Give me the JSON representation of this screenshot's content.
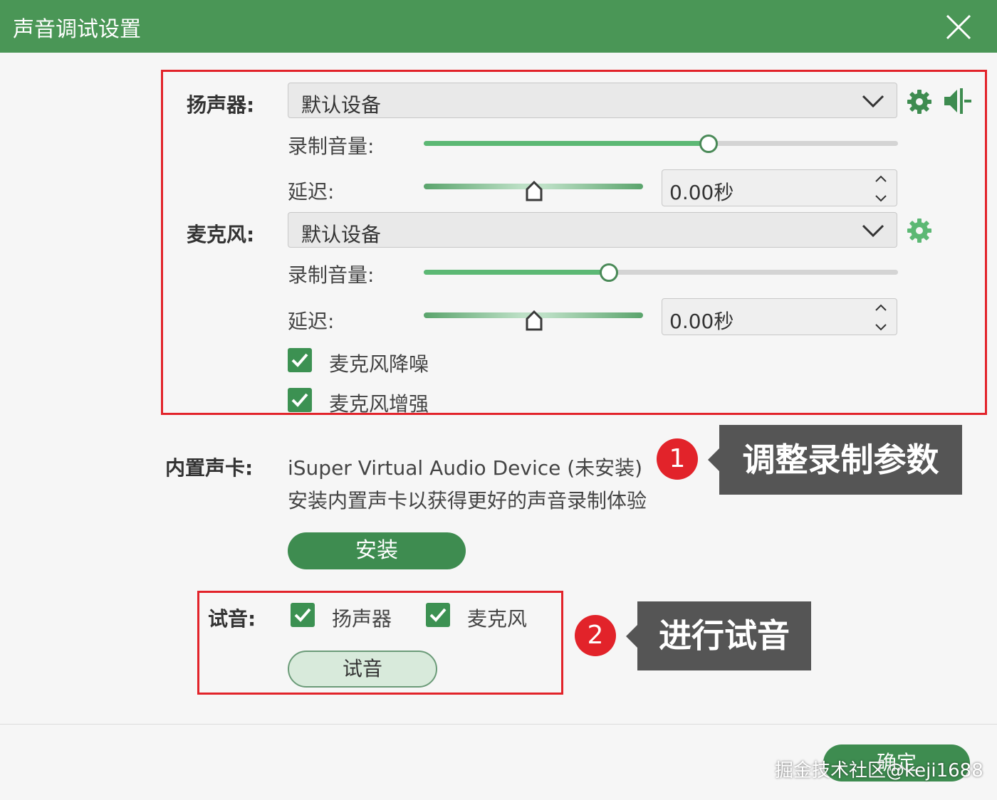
{
  "window": {
    "title": "声音调试设置"
  },
  "speaker": {
    "label": "扬声器:",
    "device": "默认设备",
    "volume_label": "录制音量:",
    "volume_level": 0.6,
    "delay_label": "延迟:",
    "delay_value": "0.00秒"
  },
  "microphone": {
    "label": "麦克风:",
    "device": "默认设备",
    "volume_label": "录制音量:",
    "volume_level": 0.39,
    "delay_label": "延迟:",
    "delay_value": "0.00秒",
    "noise_reduction_label": "麦克风降噪",
    "noise_reduction_checked": true,
    "enhance_label": "麦克风增强",
    "enhance_checked": true
  },
  "sound_card": {
    "label": "内置声卡:",
    "device": "iSuper Virtual Audio Device (未安装)",
    "hint": "安装内置声卡以获得更好的声音录制体验",
    "install_label": "安装"
  },
  "test": {
    "label": "试音:",
    "speaker_label": "扬声器",
    "speaker_checked": true,
    "mic_label": "麦克风",
    "mic_checked": true,
    "button_label": "试音"
  },
  "annotations": [
    {
      "number": "1",
      "text": "调整录制参数"
    },
    {
      "number": "2",
      "text": "进行试音"
    }
  ],
  "footer": {
    "ok_label": "确定",
    "watermark": "掘金技术社区@keji1688"
  },
  "colors": {
    "titlebar": "#4a9656",
    "accent": "#3e8c50",
    "highlight": "#e2232a"
  }
}
